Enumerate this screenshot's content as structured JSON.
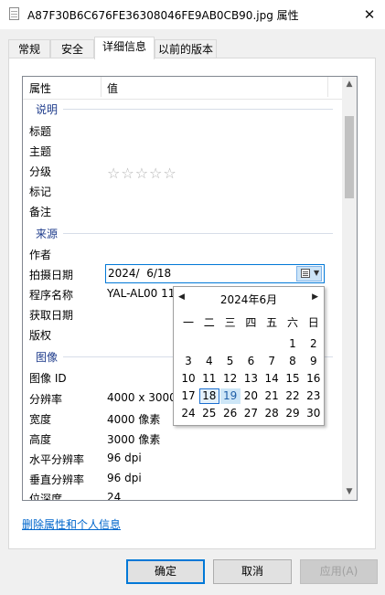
{
  "window": {
    "title": "A87F30B6C676FE36308046FE9AB0CB90.jpg 属性",
    "close_glyph": "✕",
    "icon": "image-file-icon"
  },
  "tabs": [
    {
      "label": "常规",
      "active": false
    },
    {
      "label": "安全",
      "active": false
    },
    {
      "label": "详细信息",
      "active": true
    },
    {
      "label": "以前的版本",
      "active": false
    }
  ],
  "list": {
    "headers": {
      "property": "属性",
      "value": "值"
    },
    "sections": {
      "description": "说明",
      "origin": "来源",
      "image": "图像"
    },
    "rows": [
      {
        "label": "标题",
        "value": ""
      },
      {
        "label": "主题",
        "value": ""
      },
      {
        "label": "分级",
        "value": "☆☆☆☆☆"
      },
      {
        "label": "标记",
        "value": ""
      },
      {
        "label": "备注",
        "value": ""
      },
      {
        "label": "作者",
        "value": ""
      },
      {
        "label": "拍摄日期",
        "value": "2024/  6/18"
      },
      {
        "label": "程序名称",
        "value": "YAL-AL00 11"
      },
      {
        "label": "获取日期",
        "value": ""
      },
      {
        "label": "版权",
        "value": ""
      },
      {
        "label": "图像 ID",
        "value": ""
      },
      {
        "label": "分辨率",
        "value": "4000 x 3000"
      },
      {
        "label": "宽度",
        "value": "4000 像素"
      },
      {
        "label": "高度",
        "value": "3000 像素"
      },
      {
        "label": "水平分辨率",
        "value": "96 dpi"
      },
      {
        "label": "垂直分辨率",
        "value": "96 dpi"
      },
      {
        "label": "位深度",
        "value": "24"
      }
    ]
  },
  "calendar": {
    "title": "2024年6月",
    "prev_glyph": "◀",
    "next_glyph": "▶",
    "weekdays": [
      "一",
      "二",
      "三",
      "四",
      "五",
      "六",
      "日"
    ],
    "weeks": [
      [
        "",
        "",
        "",
        "",
        "",
        "1",
        "2"
      ],
      [
        "3",
        "4",
        "5",
        "6",
        "7",
        "8",
        "9"
      ],
      [
        "10",
        "11",
        "12",
        "13",
        "14",
        "15",
        "16"
      ],
      [
        "17",
        "18",
        "19",
        "20",
        "21",
        "22",
        "23"
      ],
      [
        "24",
        "25",
        "26",
        "27",
        "28",
        "29",
        "30"
      ]
    ],
    "selected_day": "18",
    "today_day": "19"
  },
  "footer": {
    "remove_link": "删除属性和个人信息"
  },
  "buttons": {
    "ok": "确定",
    "cancel": "取消",
    "apply": "应用(A)"
  },
  "colors": {
    "section_title": "#1f3c8c",
    "link": "#0066cc",
    "accent": "#0078d7"
  }
}
